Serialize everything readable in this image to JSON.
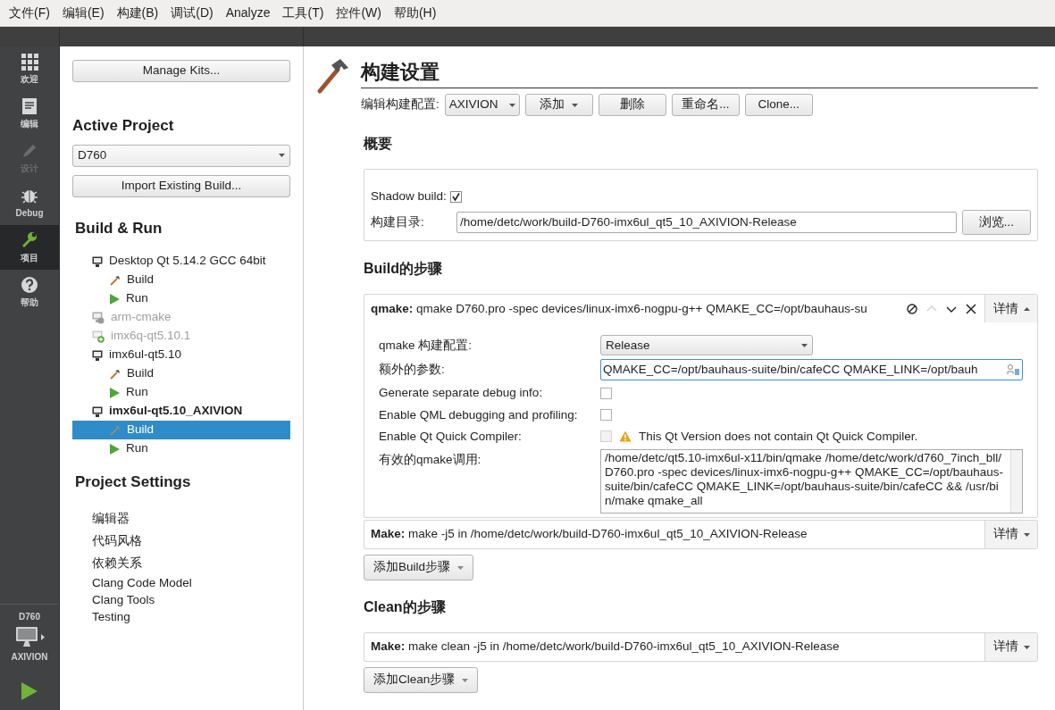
{
  "menu": [
    "文件(F)",
    "编辑(E)",
    "构建(B)",
    "调试(D)",
    "Analyze",
    "工具(T)",
    "控件(W)",
    "帮助(H)"
  ],
  "modes": [
    {
      "kind": "welcome",
      "label": "欢迎",
      "selected": false,
      "disabled": false
    },
    {
      "kind": "edit",
      "label": "编辑",
      "selected": false,
      "disabled": false
    },
    {
      "kind": "design",
      "label": "设计",
      "selected": false,
      "disabled": true
    },
    {
      "kind": "debug",
      "label": "Debug",
      "selected": false,
      "disabled": false
    },
    {
      "kind": "projects",
      "label": "项目",
      "selected": true,
      "disabled": false
    },
    {
      "kind": "help",
      "label": "帮助",
      "selected": false,
      "disabled": false
    }
  ],
  "target": {
    "project": "D760",
    "config": "AXIVION"
  },
  "projects_panel": {
    "manage_kits": "Manage Kits...",
    "active_project_heading": "Active Project",
    "active_project": "D760",
    "import_button": "Import Existing Build...",
    "build_run_heading": "Build & Run",
    "kits": [
      {
        "name": "Desktop Qt 5.14.2 GCC 64bit",
        "kind": "configured",
        "current": false,
        "children": [
          {
            "kind": "build",
            "label": "Build",
            "selected": false
          },
          {
            "kind": "run",
            "label": "Run",
            "selected": false
          }
        ]
      },
      {
        "name": "arm-cmake",
        "kind": "inactive",
        "current": false
      },
      {
        "name": "imx6q-qt5.10.1",
        "kind": "available",
        "current": false
      },
      {
        "name": "imx6ul-qt5.10",
        "kind": "configured",
        "current": false,
        "children": [
          {
            "kind": "build",
            "label": "Build",
            "selected": false
          },
          {
            "kind": "run",
            "label": "Run",
            "selected": false
          }
        ]
      },
      {
        "name": "imx6ul-qt5.10_AXIVION",
        "kind": "configured",
        "current": true,
        "children": [
          {
            "kind": "build",
            "label": "Build",
            "selected": true
          },
          {
            "kind": "run",
            "label": "Run",
            "selected": false
          }
        ]
      }
    ],
    "settings_heading": "Project Settings",
    "settings": [
      "编辑器",
      "代码风格",
      "依赖关系",
      "Clang Code Model",
      "Clang Tools",
      "Testing"
    ]
  },
  "build_settings": {
    "title": "构建设置",
    "config_label": "编辑构建配置:",
    "config": "AXIVION",
    "buttons": [
      {
        "label": "添加",
        "menu": true
      },
      {
        "label": "删除",
        "menu": false
      },
      {
        "label": "重命名...",
        "menu": false
      },
      {
        "label": "Clone...",
        "menu": false
      }
    ],
    "overview_heading": "概要",
    "shadow_build_label": "Shadow build:",
    "shadow_build": true,
    "dir_label": "构建目录:",
    "dir": "/home/detc/work/build-D760-imx6ul_qt5_10_AXIVION-Release",
    "browse": "浏览...",
    "build_heading": "Build的步骤",
    "build_steps": [
      {
        "summary": "**qmake:** qmake D760.pro -spec devices/linux-imx6-nogpu-g++ QMAKE_CC=/opt/bauhaus-su",
        "details": "详情",
        "expanded": true,
        "tools": [
          {
            "kind": "disable",
            "disabled": false
          },
          {
            "kind": "up",
            "disabled": true
          },
          {
            "kind": "down",
            "disabled": false
          },
          {
            "kind": "remove",
            "disabled": false
          }
        ],
        "fields": [
          {
            "kind": "combo",
            "label": "qmake 构建配置:",
            "value": "Release"
          },
          {
            "kind": "text",
            "label": "额外的参数:",
            "value": "QMAKE_CC=/opt/bauhaus-suite/bin/cafeCC QMAKE_LINK=/opt/bauh"
          },
          {
            "kind": "checkbox",
            "label": "Generate separate debug info:",
            "checked": false,
            "disabled": false
          },
          {
            "kind": "checkbox",
            "label": "Enable QML debugging and profiling:",
            "checked": false,
            "disabled": false
          },
          {
            "kind": "checkbox",
            "label": "Enable Qt Quick Compiler:",
            "checked": false,
            "disabled": true,
            "warning": "This Qt Version does not contain Qt Quick Compiler."
          },
          {
            "kind": "textarea",
            "label": "有效的qmake调用:",
            "value": "/home/detc/qt5.10-imx6ul-x11/bin/qmake /home/detc/work/d760_7inch_bll/D760.pro -spec devices/linux-imx6-nogpu-g++ QMAKE_CC=/opt/bauhaus-suite/bin/cafeCC QMAKE_LINK=/opt/bauhaus-suite/bin/cafeCC && /usr/bin/make qmake_all"
          }
        ]
      },
      {
        "summary": "**Make:** make -j5 in /home/detc/work/build-D760-imx6ul_qt5_10_AXIVION-Release",
        "details": "详情",
        "expanded": false
      }
    ],
    "add_build_step": "添加Build步骤",
    "clean_heading": "Clean的步骤",
    "clean_steps": [
      {
        "summary": "**Make:** make clean -j5 in /home/detc/work/build-D760-imx6ul_qt5_10_AXIVION-Release",
        "details": "详情",
        "expanded": false
      }
    ],
    "add_clean_step": "添加Clean步骤"
  }
}
